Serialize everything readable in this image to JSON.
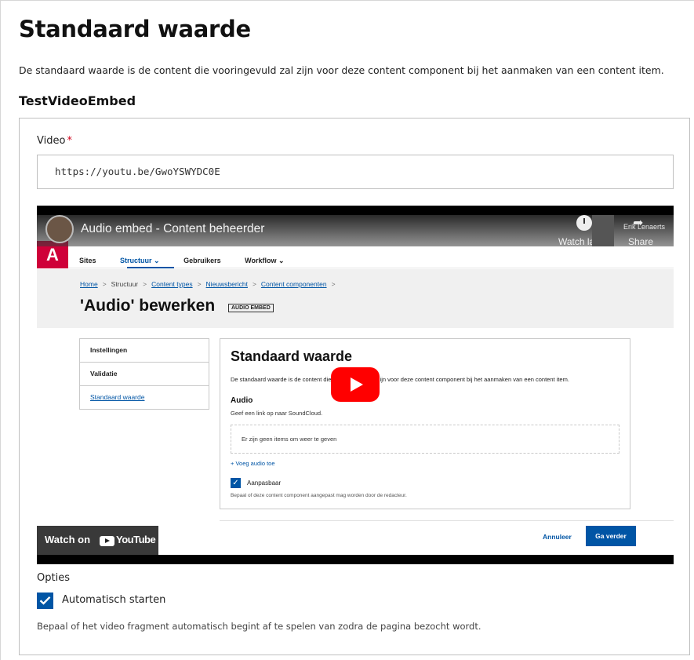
{
  "page": {
    "title": "Standaard waarde",
    "intro": "De standaard waarde is de content die vooringevuld zal zijn voor deze content component bij het aanmaken van een content item.",
    "component_name": "TestVideoEmbed"
  },
  "video_field": {
    "label": "Video",
    "required_marker": "*",
    "value": "https://youtu.be/GwoYSWYDC0E"
  },
  "player": {
    "video_title": "Audio embed - Content beheerder",
    "watch_later": "Watch later",
    "share": "Share",
    "channel_user": "Erik Lenaerts",
    "watch_on": "Watch on",
    "youtube_word": "YouTube",
    "cms": {
      "logo": "A",
      "nav": [
        "Sites",
        "Structuur ⌄",
        "Gebruikers",
        "Workflow ⌄"
      ],
      "breadcrumb": [
        "Home",
        "Structuur",
        "Content types",
        "Nieuwsbericht",
        "Content componenten"
      ],
      "heading": "'Audio' bewerken",
      "badge": "AUDIO EMBED",
      "sidebar": [
        "Instellingen",
        "Validatie",
        "Standaard waarde"
      ],
      "card_title": "Standaard waarde",
      "card_text": "De standaard waarde is de content die vooringevuld zal zijn voor deze content component bij het aanmaken van een content item.",
      "audio_label": "Audio",
      "audio_hint": "Geef een link op naar SoundCloud.",
      "empty_text": "Er zijn geen items om weer te geven",
      "add_link": "+ Voeg audio toe",
      "check_label": "Aanpasbaar",
      "check_hint": "Bepaal of deze content component aangepast mag worden door de redacteur.",
      "cancel": "Annuleer",
      "next": "Ga verder"
    }
  },
  "options": {
    "label": "Opties",
    "autoplay_label": "Automatisch starten",
    "autoplay_checked": true,
    "autoplay_hint": "Bepaal of het video fragment automatisch begint af te spelen van zodra de pagina bezocht wordt."
  },
  "colors": {
    "accent": "#0055a5",
    "required": "#d0021b",
    "youtube_red": "#ff0000",
    "brand_red": "#cf0039"
  }
}
